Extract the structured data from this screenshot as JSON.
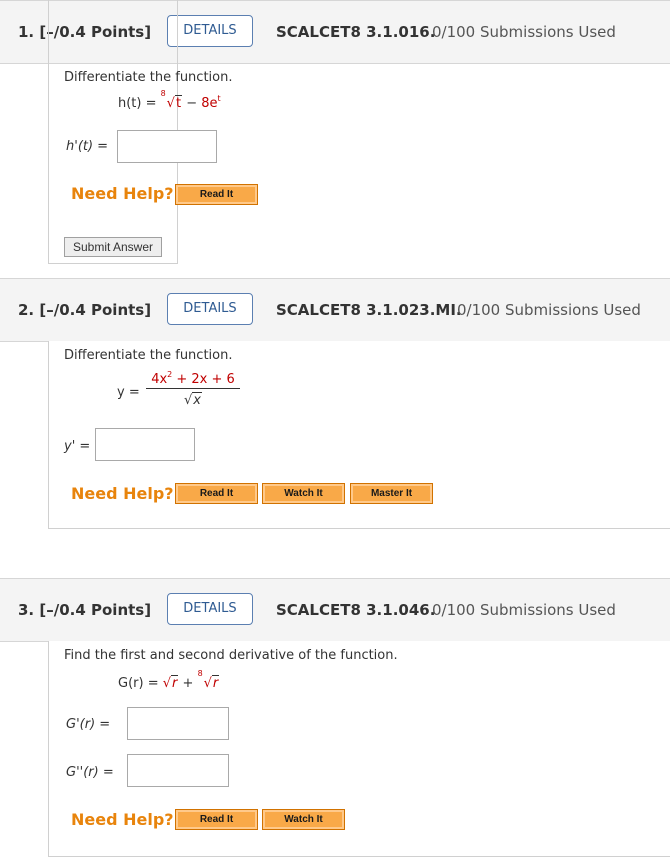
{
  "questions": [
    {
      "number": "1.",
      "points": "[–/0.4 Points]",
      "details_label": "DETAILS",
      "code": "SCALCET8 3.1.016.",
      "submissions": "0/100 Submissions Used",
      "prompt": "Differentiate the function.",
      "function": {
        "lhs": "h(t) =",
        "root_index": "8",
        "radicand": "t",
        "minus": "−",
        "coef": "8",
        "base": "e",
        "exp": "t"
      },
      "answer_label": "h'(t) =",
      "need_help": "Need Help?",
      "help_buttons": [
        "Read It"
      ],
      "submit_label": "Submit Answer"
    },
    {
      "number": "2.",
      "points": "[–/0.4 Points]",
      "details_label": "DETAILS",
      "code": "SCALCET8 3.1.023.MI.",
      "submissions": "0/100 Submissions Used",
      "prompt": "Differentiate the function.",
      "function": {
        "lhs": "y =",
        "num_a": "4x",
        "num_a_exp": "2",
        "num_rest": " + 2x + 6",
        "den_radicand": "x"
      },
      "answer_label": "y' =",
      "need_help": "Need Help?",
      "help_buttons": [
        "Read It",
        "Watch It",
        "Master It"
      ]
    },
    {
      "number": "3.",
      "points": "[–/0.4 Points]",
      "details_label": "DETAILS",
      "code": "SCALCET8 3.1.046.",
      "submissions": "0/100 Submissions Used",
      "prompt": "Find the first and second derivative of the function.",
      "function": {
        "lhs": "G(r) =",
        "radicand1": "r",
        "plus": "+",
        "root_index": "8",
        "radicand2": "r"
      },
      "answer_labels": [
        "G'(r)   =",
        "G''(r)  ="
      ],
      "need_help": "Need Help?",
      "help_buttons": [
        "Read It",
        "Watch It"
      ]
    }
  ],
  "colors": {
    "help_orange": "#e8840c",
    "button_orange": "#f9a948",
    "details_blue": "#2f5b92",
    "math_red": "#c00000"
  }
}
